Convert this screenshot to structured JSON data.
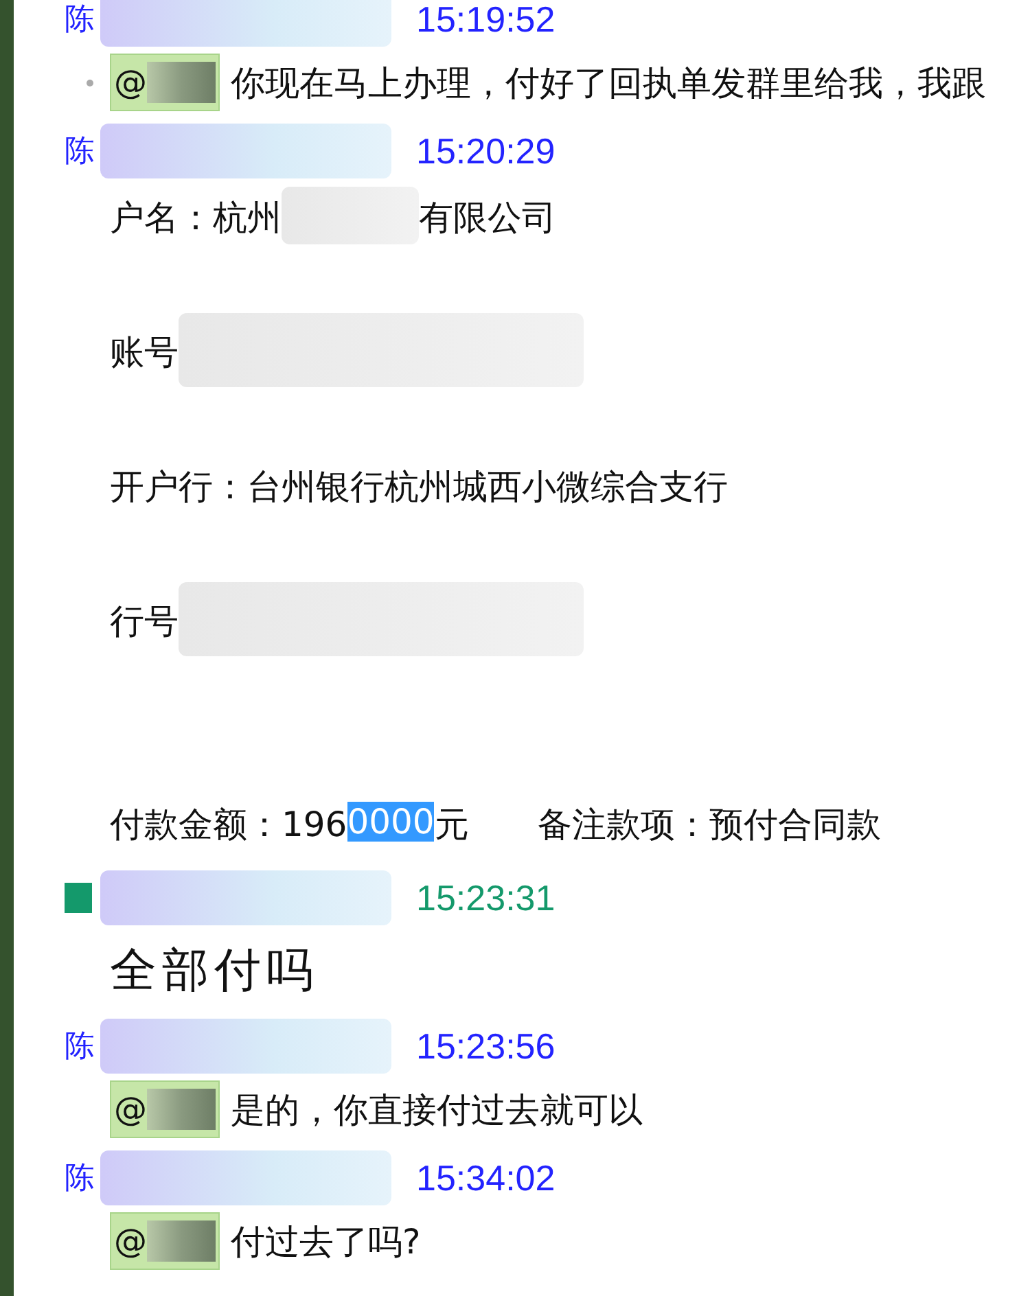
{
  "messages": [
    {
      "sender": "陈",
      "color": "#2323ff",
      "time": "15:19:52",
      "marked": true,
      "body": [
        {
          "kind": "mention",
          "at": "@",
          "text": "你现在马上办理，付好了回执单发群里给我，我跟"
        }
      ]
    },
    {
      "sender": "陈",
      "color": "#2323ff",
      "time": "15:20:29",
      "marked": false,
      "body": [
        {
          "kind": "detail",
          "segments": [
            {
              "kind": "text",
              "text": "户名：杭州"
            },
            {
              "kind": "blur"
            },
            {
              "kind": "text",
              "text": "有限公司"
            }
          ]
        },
        {
          "kind": "detail",
          "segments": [
            {
              "kind": "text",
              "text": "账号"
            },
            {
              "kind": "blur"
            }
          ]
        },
        {
          "kind": "detail",
          "segments": [
            {
              "kind": "text",
              "text": "开户行：台州银行杭州城西小微综合支行"
            }
          ]
        },
        {
          "kind": "detail",
          "segments": [
            {
              "kind": "text",
              "text": "行号"
            },
            {
              "kind": "blur"
            }
          ]
        },
        {
          "kind": "detail",
          "segments": [
            {
              "kind": "text",
              "text": "付款金额：196"
            },
            {
              "kind": "selection",
              "text": "0000"
            },
            {
              "kind": "text",
              "text": "元"
            },
            {
              "kind": "tab"
            },
            {
              "kind": "text",
              "text": "备注款项：预付合同款"
            }
          ]
        }
      ]
    },
    {
      "color": "#14996b",
      "time": "15:23:31",
      "marked": false,
      "body": [
        {
          "kind": "large",
          "text": "全部付吗"
        }
      ]
    },
    {
      "sender": "陈",
      "color": "#2323ff",
      "time": "15:23:56",
      "marked": false,
      "body": [
        {
          "kind": "mention",
          "at": "@",
          "text": "是的，你直接付过去就可以"
        }
      ]
    },
    {
      "sender": "陈",
      "color": "#2323ff",
      "time": "15:34:02",
      "marked": false,
      "body": [
        {
          "kind": "mention",
          "at": "@",
          "text": "付过去了吗?"
        }
      ]
    }
  ]
}
